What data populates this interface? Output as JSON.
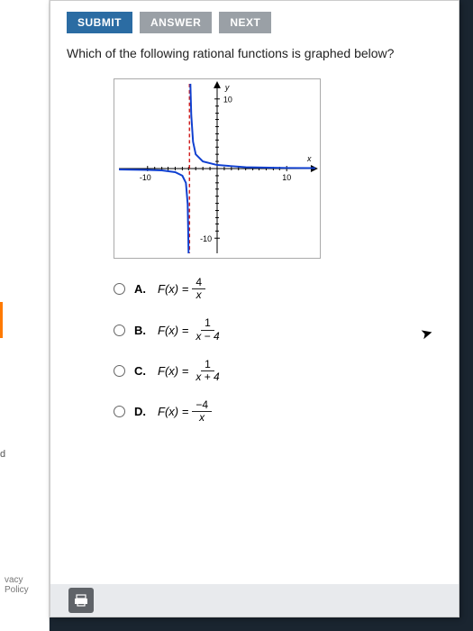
{
  "buttons": {
    "submit": "SUBMIT",
    "answer": "ANSWER",
    "next": "NEXT"
  },
  "question": "Which of the following rational functions is graphed below?",
  "sidebar": {
    "d_text": "d",
    "privacy": "vacy Policy"
  },
  "chart_data": {
    "type": "line",
    "title": "",
    "xlabel": "x",
    "ylabel": "y",
    "xlim": [
      -14,
      14
    ],
    "ylim": [
      -14,
      14
    ],
    "ticks": {
      "x": [
        -10,
        10
      ],
      "y": [
        -10,
        10
      ]
    },
    "vertical_asymptote": -4,
    "horizontal_asymptote": 0,
    "function": "1/(x+4)",
    "series": [
      {
        "name": "left-branch",
        "x": [
          -14,
          -10,
          -8,
          -6,
          -5,
          -4.5,
          -4.2,
          -4.1
        ],
        "y": [
          -0.1,
          -0.17,
          -0.25,
          -0.5,
          -1,
          -2,
          -5,
          -10
        ]
      },
      {
        "name": "right-branch",
        "x": [
          -3.9,
          -3.8,
          -3.5,
          -3,
          -2,
          0,
          4,
          10,
          14
        ],
        "y": [
          10,
          5,
          2,
          1,
          0.5,
          0.25,
          0.125,
          0.07,
          0.055
        ]
      }
    ]
  },
  "graph_labels": {
    "y": "y",
    "x": "x",
    "neg10x": "-10",
    "pos10x": "10",
    "pos10y": "10",
    "neg10y": "-10"
  },
  "options": {
    "a": {
      "label": "A.",
      "lhs": "F(x) =",
      "num": "4",
      "den": "x"
    },
    "b": {
      "label": "B.",
      "lhs": "F(x) =",
      "num": "1",
      "den": "x − 4"
    },
    "c": {
      "label": "C.",
      "lhs": "F(x) =",
      "num": "1",
      "den": "x + 4"
    },
    "d": {
      "label": "D.",
      "lhs": "F(x) =",
      "num": "−4",
      "den": "x"
    }
  }
}
